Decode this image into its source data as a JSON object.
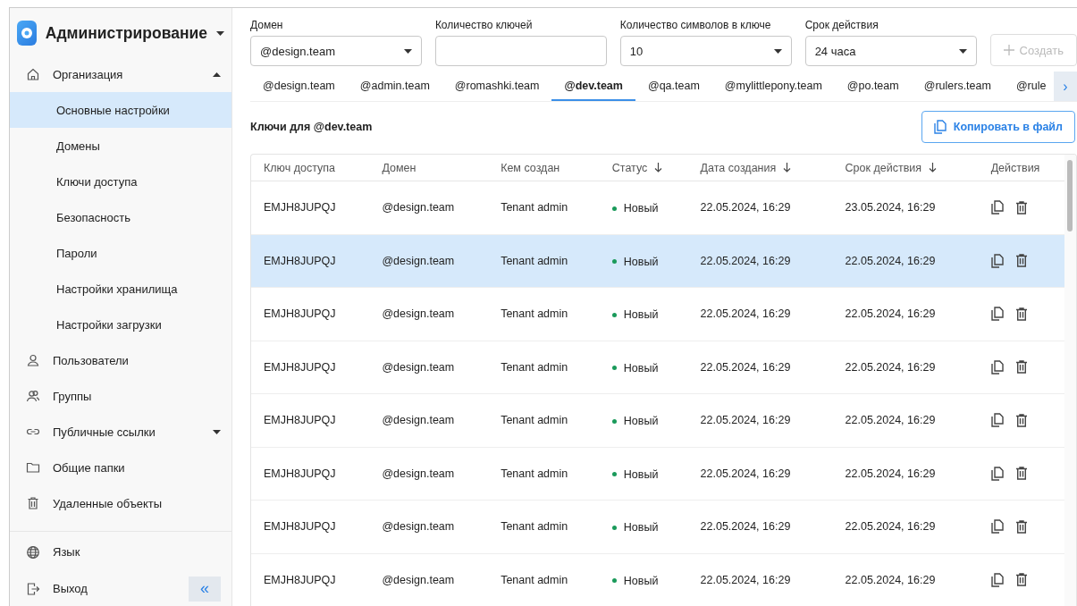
{
  "sidebar": {
    "title": "Администрирование",
    "items": [
      {
        "label": "Организация",
        "expanded": true,
        "children": [
          {
            "label": "Основные настройки",
            "selected": true
          },
          {
            "label": "Домены",
            "selected": false
          },
          {
            "label": "Ключи доступа",
            "selected": false
          },
          {
            "label": "Безопасность",
            "selected": false
          },
          {
            "label": "Пароли",
            "selected": false
          },
          {
            "label": "Настройки хранилища",
            "selected": false
          },
          {
            "label": "Настройки загрузки",
            "selected": false
          }
        ]
      },
      {
        "label": "Пользователи"
      },
      {
        "label": "Группы"
      },
      {
        "label": "Публичные ссылки",
        "expanded": false
      },
      {
        "label": "Общие папки"
      },
      {
        "label": "Удаленные объекты"
      }
    ],
    "footer": [
      {
        "label": "Язык"
      },
      {
        "label": "Выход"
      }
    ],
    "collapse_button": "«"
  },
  "form": {
    "fields": [
      {
        "label": "Домен",
        "value": "@design.team",
        "kind": "select"
      },
      {
        "label": "Количество ключей",
        "kind": "input"
      },
      {
        "label": "Количество символов в ключе",
        "value": "10",
        "kind": "select"
      },
      {
        "label": "Срок действия",
        "value": "24 часа",
        "kind": "select"
      }
    ],
    "create_button": {
      "label": "Создать",
      "disabled": true
    }
  },
  "tabs": [
    {
      "label": "@design.team",
      "selected": false
    },
    {
      "label": "@admin.team",
      "selected": false
    },
    {
      "label": "@romashki.team",
      "selected": false
    },
    {
      "label": "@dev.team",
      "selected": true
    },
    {
      "label": "@qa.team",
      "selected": false
    },
    {
      "label": "@mylittlepony.team",
      "selected": false
    },
    {
      "label": "@po.team",
      "selected": false
    },
    {
      "label": "@rulers.team",
      "selected": false
    },
    {
      "label": "@rule",
      "selected": false
    }
  ],
  "tabs_scroll_button": "›",
  "section_title": "Ключи для @dev.team",
  "copy_button": "Копировать в файл",
  "table": {
    "columns": [
      {
        "label": "Ключ доступа",
        "sorted": false
      },
      {
        "label": "Домен",
        "sorted": false
      },
      {
        "label": "Кем создан",
        "sorted": false
      },
      {
        "label": "Статус",
        "sorted": true
      },
      {
        "label": "Дата создания",
        "sorted": true
      },
      {
        "label": "Срок действия",
        "sorted": true
      },
      {
        "label": "Действия",
        "sorted": false
      }
    ],
    "rows": [
      {
        "key": "EMJH8JUPQJ",
        "domain": "@design.team",
        "creator": "Tenant admin",
        "status": "Новый",
        "color": "#1a9a5a",
        "created": "22.05.2024, 16:29",
        "expires": "23.05.2024, 16:29",
        "selected": false
      },
      {
        "key": "EMJH8JUPQJ",
        "domain": "@design.team",
        "creator": "Tenant admin",
        "status": "Новый",
        "color": "#1a9a5a",
        "created": "22.05.2024, 16:29",
        "expires": "22.05.2024, 16:29",
        "selected": true
      },
      {
        "key": "EMJH8JUPQJ",
        "domain": "@design.team",
        "creator": "Tenant admin",
        "status": "Новый",
        "color": "#1a9a5a",
        "created": "22.05.2024, 16:29",
        "expires": "22.05.2024, 16:29",
        "selected": false
      },
      {
        "key": "EMJH8JUPQJ",
        "domain": "@design.team",
        "creator": "Tenant admin",
        "status": "Новый",
        "color": "#1a9a5a",
        "created": "22.05.2024, 16:29",
        "expires": "22.05.2024, 16:29",
        "selected": false
      },
      {
        "key": "EMJH8JUPQJ",
        "domain": "@design.team",
        "creator": "Tenant admin",
        "status": "Новый",
        "color": "#1a9a5a",
        "created": "22.05.2024, 16:29",
        "expires": "22.05.2024, 16:29",
        "selected": false
      },
      {
        "key": "EMJH8JUPQJ",
        "domain": "@design.team",
        "creator": "Tenant admin",
        "status": "Новый",
        "color": "#1a9a5a",
        "created": "22.05.2024, 16:29",
        "expires": "22.05.2024, 16:29",
        "selected": false
      },
      {
        "key": "EMJH8JUPQJ",
        "domain": "@design.team",
        "creator": "Tenant admin",
        "status": "Новый",
        "color": "#1a9a5a",
        "created": "22.05.2024, 16:29",
        "expires": "22.05.2024, 16:29",
        "selected": false
      },
      {
        "key": "EMJH8JUPQJ",
        "domain": "@design.team",
        "creator": "Tenant admin",
        "status": "Новый",
        "color": "#1a9a5a",
        "created": "22.05.2024, 16:29",
        "expires": "22.05.2024, 16:29",
        "selected": false
      }
    ]
  }
}
